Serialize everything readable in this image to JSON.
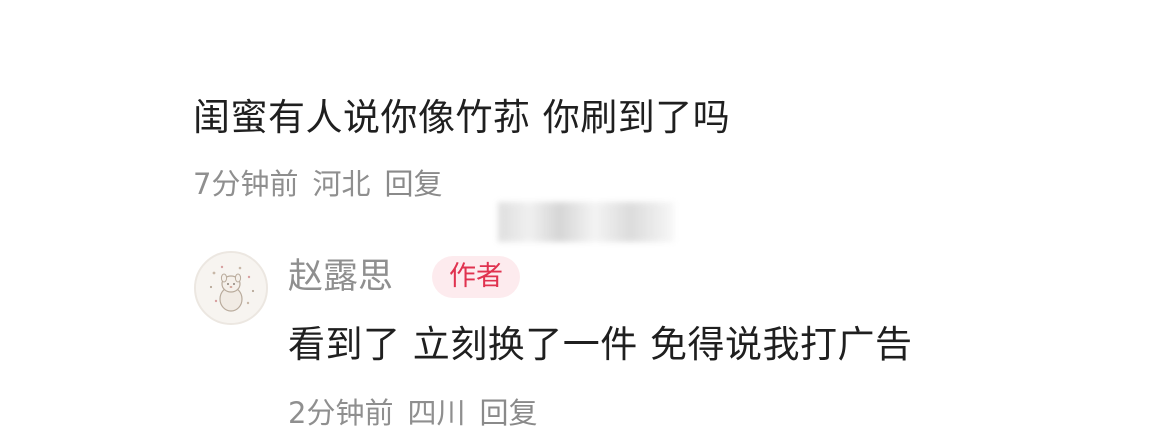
{
  "comments": {
    "main": {
      "text": "闺蜜有人说你像竹荪 你刷到了吗",
      "time": "7分钟前",
      "location": "河北",
      "reply_label": "回复"
    },
    "reply": {
      "author": "赵露思",
      "badge": "作者",
      "text": "看到了 立刻换了一件 免得说我打广告",
      "time": "2分钟前",
      "location": "四川",
      "reply_label": "回复"
    }
  },
  "colors": {
    "text": "#1f1f1f",
    "meta": "#8f8f8f",
    "badge_bg": "#fdebee",
    "badge_text": "#e0324f"
  },
  "icons": {
    "avatar": "cartoon-avatar-icon"
  }
}
